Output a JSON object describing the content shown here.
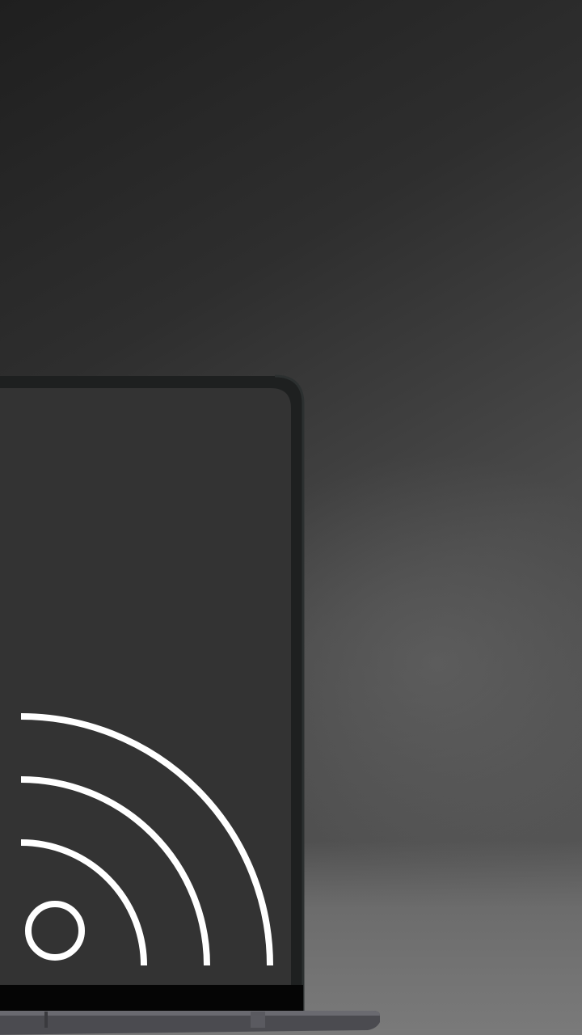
{
  "scene": {
    "subject": "laptop",
    "icon": "cast-icon"
  },
  "colors": {
    "background_dark": "#1f1f1f",
    "background_light": "#5a5a5a",
    "floor": "#7a7a7a",
    "laptop_bezel": "#1e2020",
    "laptop_screen": "#333333",
    "laptop_base": "#4a4a4e",
    "icon_stroke": "#ffffff"
  }
}
